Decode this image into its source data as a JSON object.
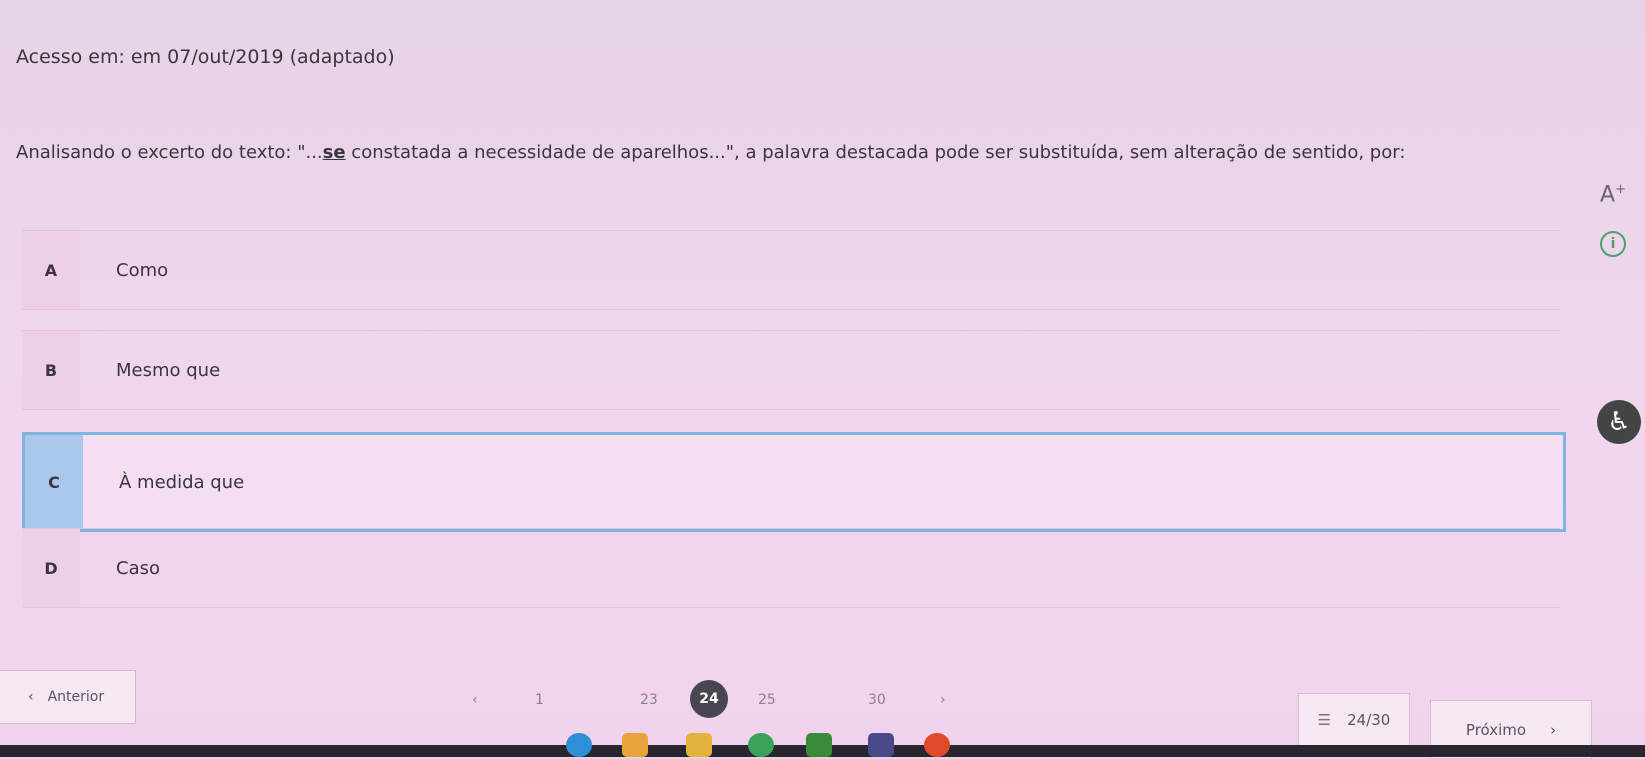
{
  "source_line": "Acesso em: em 07/out/2019 (adaptado)",
  "question": {
    "before": "Analisando o excerto do texto: \"...",
    "highlight": "se",
    "after": " constatada a necessidade de aparelhos...\", a palavra destacada pode ser substituída, sem alteração de sentido, por:"
  },
  "tools": {
    "font_size_label": "A",
    "font_size_sup": "+",
    "info_glyph": "i",
    "accessibility_glyph": "♿"
  },
  "options": [
    {
      "letter": "A",
      "text": "Como",
      "selected": false
    },
    {
      "letter": "B",
      "text": "Mesmo que",
      "selected": false
    },
    {
      "letter": "C",
      "text": "À medida que",
      "selected": true
    },
    {
      "letter": "D",
      "text": "Caso",
      "selected": false
    }
  ],
  "navigation": {
    "prev_label": "Anterior",
    "next_label": "Próximo",
    "pages": [
      "1",
      "23",
      "24",
      "25",
      "30"
    ],
    "current_page": "24",
    "counter": "24/30"
  },
  "colors": {
    "selected_border": "#7fb4e0",
    "selected_letter_bg": "#a9c8eb",
    "current_page_bg": "#4a4550"
  }
}
